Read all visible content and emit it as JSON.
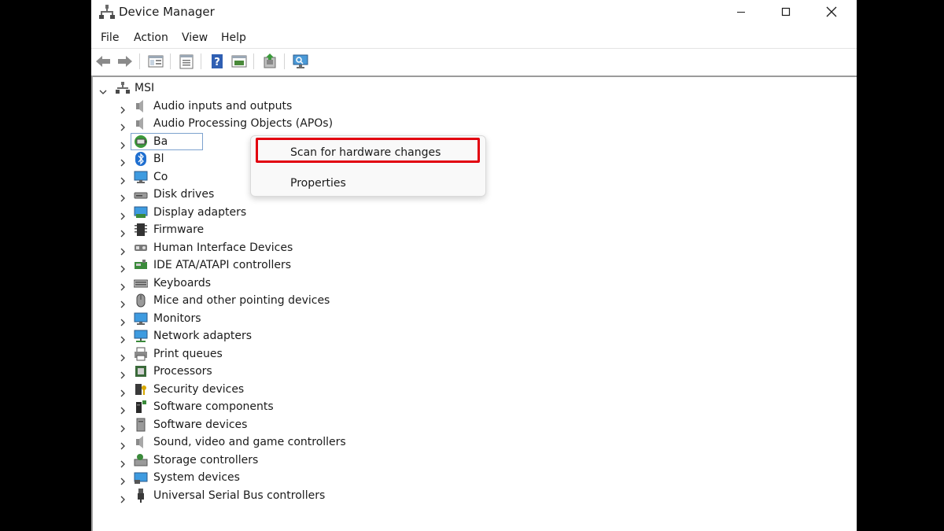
{
  "window": {
    "title": "Device Manager"
  },
  "menubar": {
    "items": [
      "File",
      "Action",
      "View",
      "Help"
    ]
  },
  "toolbar": {
    "buttons": [
      "back-icon",
      "forward-icon",
      "show-hide-tree-icon",
      "properties-icon",
      "help-icon",
      "view-icon",
      "update-driver-icon",
      "scan-hardware-icon"
    ]
  },
  "tree": {
    "root": "MSI",
    "items": [
      {
        "label": "Audio inputs and outputs",
        "icon": "speaker-icon"
      },
      {
        "label": "Audio Processing Objects (APOs)",
        "icon": "speaker-icon"
      },
      {
        "label": "Ba",
        "icon": "battery-icon"
      },
      {
        "label": "Bl",
        "icon": "bluetooth-icon"
      },
      {
        "label": "Co",
        "icon": "computer-icon"
      },
      {
        "label": "Disk drives",
        "icon": "disk-drive-icon"
      },
      {
        "label": "Display adapters",
        "icon": "display-adapter-icon"
      },
      {
        "label": "Firmware",
        "icon": "firmware-icon"
      },
      {
        "label": "Human Interface Devices",
        "icon": "hid-icon"
      },
      {
        "label": "IDE ATA/ATAPI controllers",
        "icon": "ide-controller-icon"
      },
      {
        "label": "Keyboards",
        "icon": "keyboard-icon"
      },
      {
        "label": "Mice and other pointing devices",
        "icon": "mouse-icon"
      },
      {
        "label": "Monitors",
        "icon": "monitor-icon"
      },
      {
        "label": "Network adapters",
        "icon": "network-adapter-icon"
      },
      {
        "label": "Print queues",
        "icon": "printer-icon"
      },
      {
        "label": "Processors",
        "icon": "processor-icon"
      },
      {
        "label": "Security devices",
        "icon": "security-device-icon"
      },
      {
        "label": "Software components",
        "icon": "software-component-icon"
      },
      {
        "label": "Software devices",
        "icon": "software-device-icon"
      },
      {
        "label": "Sound, video and game controllers",
        "icon": "speaker-icon"
      },
      {
        "label": "Storage controllers",
        "icon": "storage-controller-icon"
      },
      {
        "label": "System devices",
        "icon": "system-devices-icon"
      },
      {
        "label": "Universal Serial Bus controllers",
        "icon": "usb-icon"
      }
    ]
  },
  "context_menu": {
    "items": [
      "Scan for hardware changes",
      "Properties"
    ]
  },
  "colors": {
    "highlight": "#e2000f",
    "accent": "#0067c0"
  }
}
